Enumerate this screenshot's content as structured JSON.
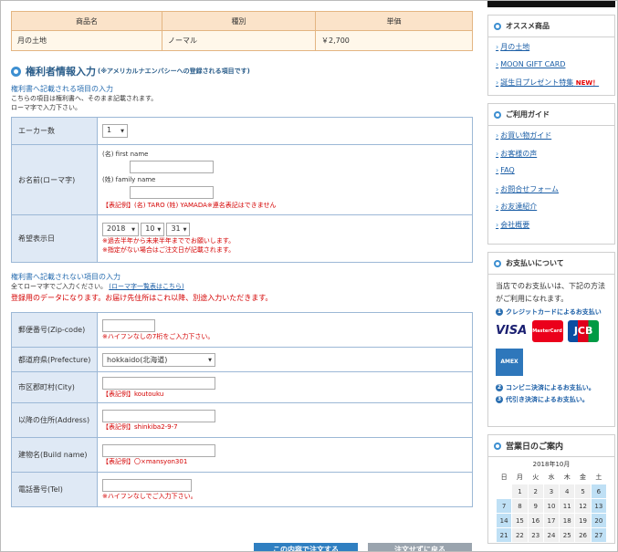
{
  "product_table": {
    "headers": [
      "商品名",
      "種別",
      "単価"
    ],
    "row": [
      "月の土地",
      "ノーマル",
      "￥2,700"
    ]
  },
  "section": {
    "title": "権利者情報入力",
    "note": "(※アメリカルナエンバシーへの登録される項目です)",
    "sub1": "権利書へ記載される項目の入力",
    "desc1": "こちらの項目は権利書へ、そのまま記載されます。",
    "desc2": "ローマ字で入力下さい。"
  },
  "form1": {
    "acre_label": "エーカー数",
    "acre_value": "1",
    "name_label": "お名前(ローマ字)",
    "first_name_label": "(名) first name",
    "family_name_label": "(姓) family name",
    "name_example": "【表記例】(名) TARO (姓) YAMADA※連名表記はできません",
    "date_label": "希望表示日",
    "year": "2018",
    "month": "10",
    "day": "31",
    "date_note1": "※過去半年から未来半年まででお願いします。",
    "date_note2": "※指定がない場合はご注文日が記載されます。"
  },
  "section2": {
    "sub2": "権利書へ記載されない項目の入力",
    "desc3": "全てローマ字でご入力ください。",
    "romaji_link": "(ローマ字一覧表はこちら)",
    "desc4": "登録用のデータになります。お届け先住所はこれ以降、別途入力いただきます。"
  },
  "form2": {
    "zip_label": "郵便番号(Zip-code)",
    "zip_note": "※ハイフンなしの7桁をご入力下さい。",
    "pref_label": "都道府県(Prefecture)",
    "pref_value": "hokkaido(北海道)",
    "city_label": "市区郡町村(City)",
    "city_example": "【表記例】koutouku",
    "addr_label": "以降の住所(Address)",
    "addr_example": "【表記例】shinkiba2-9-7",
    "build_label": "建物名(Build name)",
    "build_example": "【表記例】〇×mansyon301",
    "tel_label": "電話番号(Tel)",
    "tel_note": "※ハイフンなしでご入力下さい。"
  },
  "buttons": {
    "order": "この内容で注文する",
    "back": "注文せずに戻る"
  },
  "sidebar": {
    "recommend_title": "オススメ商品",
    "recommend_items": [
      "月の土地",
      "MOON GIFT CARD",
      "誕生日プレゼント特集"
    ],
    "new_badge": "NEW！",
    "guide_title": "ご利用ガイド",
    "guide_items": [
      "お買い物ガイド",
      "お客様の声",
      "FAQ",
      "お問合せフォーム",
      "お友達紹介",
      "会社概要"
    ],
    "pay_title": "お支払いについて",
    "pay_desc": "当店でのお支払いは、下記の方法がご利用になれます。",
    "pay_methods": [
      "クレジットカードによるお支払い",
      "コンビニ決済によるお支払い。",
      "代引き決済によるお支払い。"
    ],
    "card_visa": "VISA",
    "card_master": "MasterCard",
    "card_jcb": "JCB",
    "card_amex": "AMEX",
    "business_title": "営業日のご案内",
    "calendar_month": "2018年10月",
    "weekdays": [
      "日",
      "月",
      "火",
      "水",
      "木",
      "金",
      "土"
    ],
    "weeks": [
      [
        "",
        "1",
        "2",
        "3",
        "4",
        "5",
        "6"
      ],
      [
        "7",
        "8",
        "9",
        "10",
        "11",
        "12",
        "13"
      ],
      [
        "14",
        "15",
        "16",
        "17",
        "18",
        "19",
        "20"
      ],
      [
        "21",
        "22",
        "23",
        "24",
        "25",
        "26",
        "27"
      ]
    ],
    "colors": {
      "accent": "#3d8fd1",
      "holiday": "#bfe0f5"
    }
  }
}
